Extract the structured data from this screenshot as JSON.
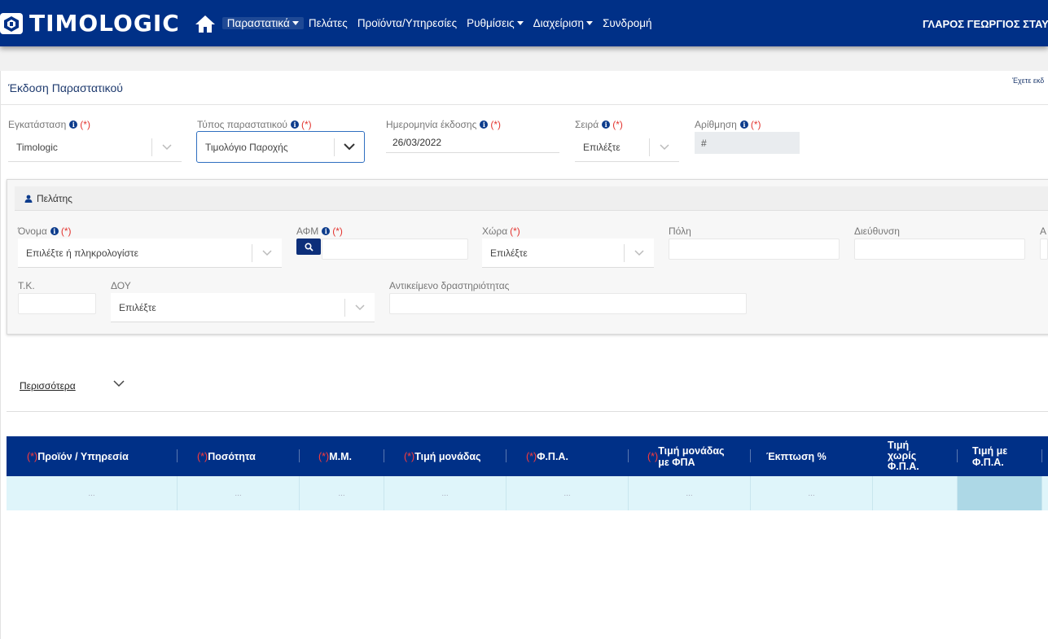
{
  "header": {
    "logo_text": "TIMOLOGIC",
    "nav": [
      {
        "label": "Παραστατικά",
        "dropdown": true
      },
      {
        "label": "Πελάτες",
        "dropdown": false
      },
      {
        "label": "Προϊόντα/Υπηρεσίες",
        "dropdown": false
      },
      {
        "label": "Ρυθμίσεις",
        "dropdown": true
      },
      {
        "label": "Διαχείριση",
        "dropdown": true
      },
      {
        "label": "Συνδρομή",
        "dropdown": false
      }
    ],
    "user_name": "ΓΛΑΡΟΣ ΓΕΩΡΓΙΟΣ ΣΤΑΥ"
  },
  "page": {
    "title": "Έκδοση Παραστατικού",
    "notice": "Έχετε εκδ"
  },
  "doc": {
    "installation_label": "Εγκατάσταση",
    "installation_value": "Timologic",
    "type_label": "Τύπος παραστατικού",
    "type_value": "Τιμολόγιο Παροχής",
    "date_label": "Ημερομηνία έκδοσης",
    "date_value": "26/03/2022",
    "series_label": "Σειρά",
    "series_value": "Επιλέξτε",
    "numbering_label": "Αρίθμηση",
    "numbering_value": "#",
    "required_mark": "(*)"
  },
  "customer": {
    "header": "Πελάτης",
    "name_label": "Όνομα",
    "name_placeholder": "Επιλέξτε ή πληκρολογίστε",
    "vat_label": "ΑΦΜ",
    "country_label": "Χώρα",
    "country_value": "Επιλέξτε",
    "city_label": "Πόλη",
    "address_label": "Διεύθυνση",
    "cut_label": "Α",
    "zip_label": "Τ.Κ.",
    "tax_office_label": "ΔΟΥ",
    "tax_office_value": "Επιλέξτε",
    "activity_label": "Αντικείμενο δραστηριότητας"
  },
  "more_label": "Περισσότερα",
  "table": {
    "columns": [
      {
        "req": "(*)",
        "label": "Προϊόν / Υπηρεσία"
      },
      {
        "req": "(*)",
        "label": "Ποσότητα"
      },
      {
        "req": "(*)",
        "label": "Μ.Μ."
      },
      {
        "req": "(*)",
        "label": "Τιμή μονάδας"
      },
      {
        "req": "(*)",
        "label": "Φ.Π.Α."
      },
      {
        "req": "(*)",
        "label1": "Τιμή μονάδας",
        "label2": "με ΦΠΑ"
      },
      {
        "req": "",
        "label": "Έκπτωση %"
      },
      {
        "req": "",
        "label1": "Τιμή",
        "label2": "χωρίς",
        "label3": "Φ.Π.Α."
      },
      {
        "req": "",
        "label1": "Τιμή με",
        "label2": "Φ.Π.Α."
      }
    ],
    "placeholder": "..."
  },
  "colors": {
    "navbar": "#003087",
    "accent": "#0d3c8c",
    "required": "#e3342f",
    "row": "#dff5fa"
  }
}
